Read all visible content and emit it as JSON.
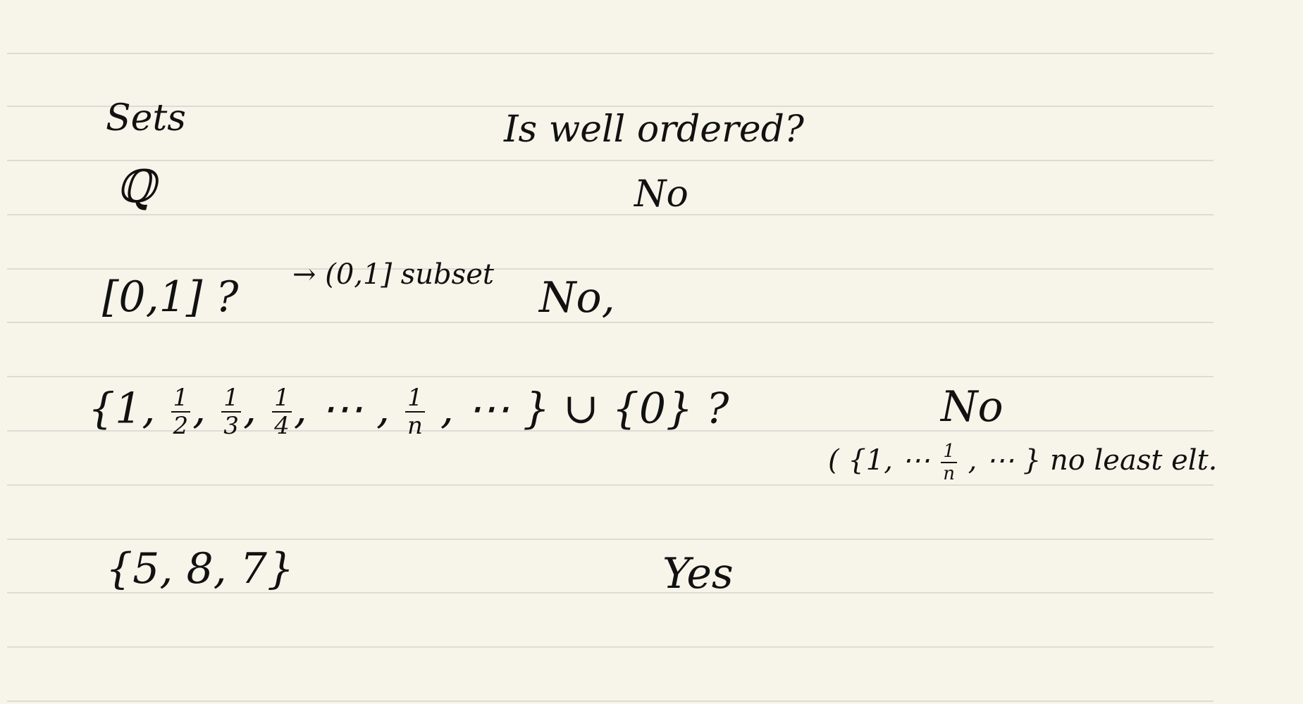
{
  "header": {
    "col_sets": "Sets",
    "col_question": "Is well ordered?"
  },
  "rows": [
    {
      "set": "ℚ",
      "answer": "No"
    },
    {
      "set": "[0,1] ?",
      "note": "→ (0,1] subset",
      "answer": "No,"
    },
    {
      "set_open": "{1,",
      "f1_num": "1",
      "f1_den": "2",
      "f2_num": "1",
      "f2_den": "3",
      "f3_num": "1",
      "f3_den": "4",
      "dots1": "⋯ ,",
      "fn_num": "1",
      "fn_den": "n",
      "set_close": ", ⋯ } ∪ {0} ?",
      "answer": "No",
      "reason_open": "( {1, ⋯",
      "reason_num": "1",
      "reason_den": "n",
      "reason_close": ", ⋯ } no least elt."
    },
    {
      "set": "{5, 8, 7}",
      "answer": "Yes"
    }
  ]
}
